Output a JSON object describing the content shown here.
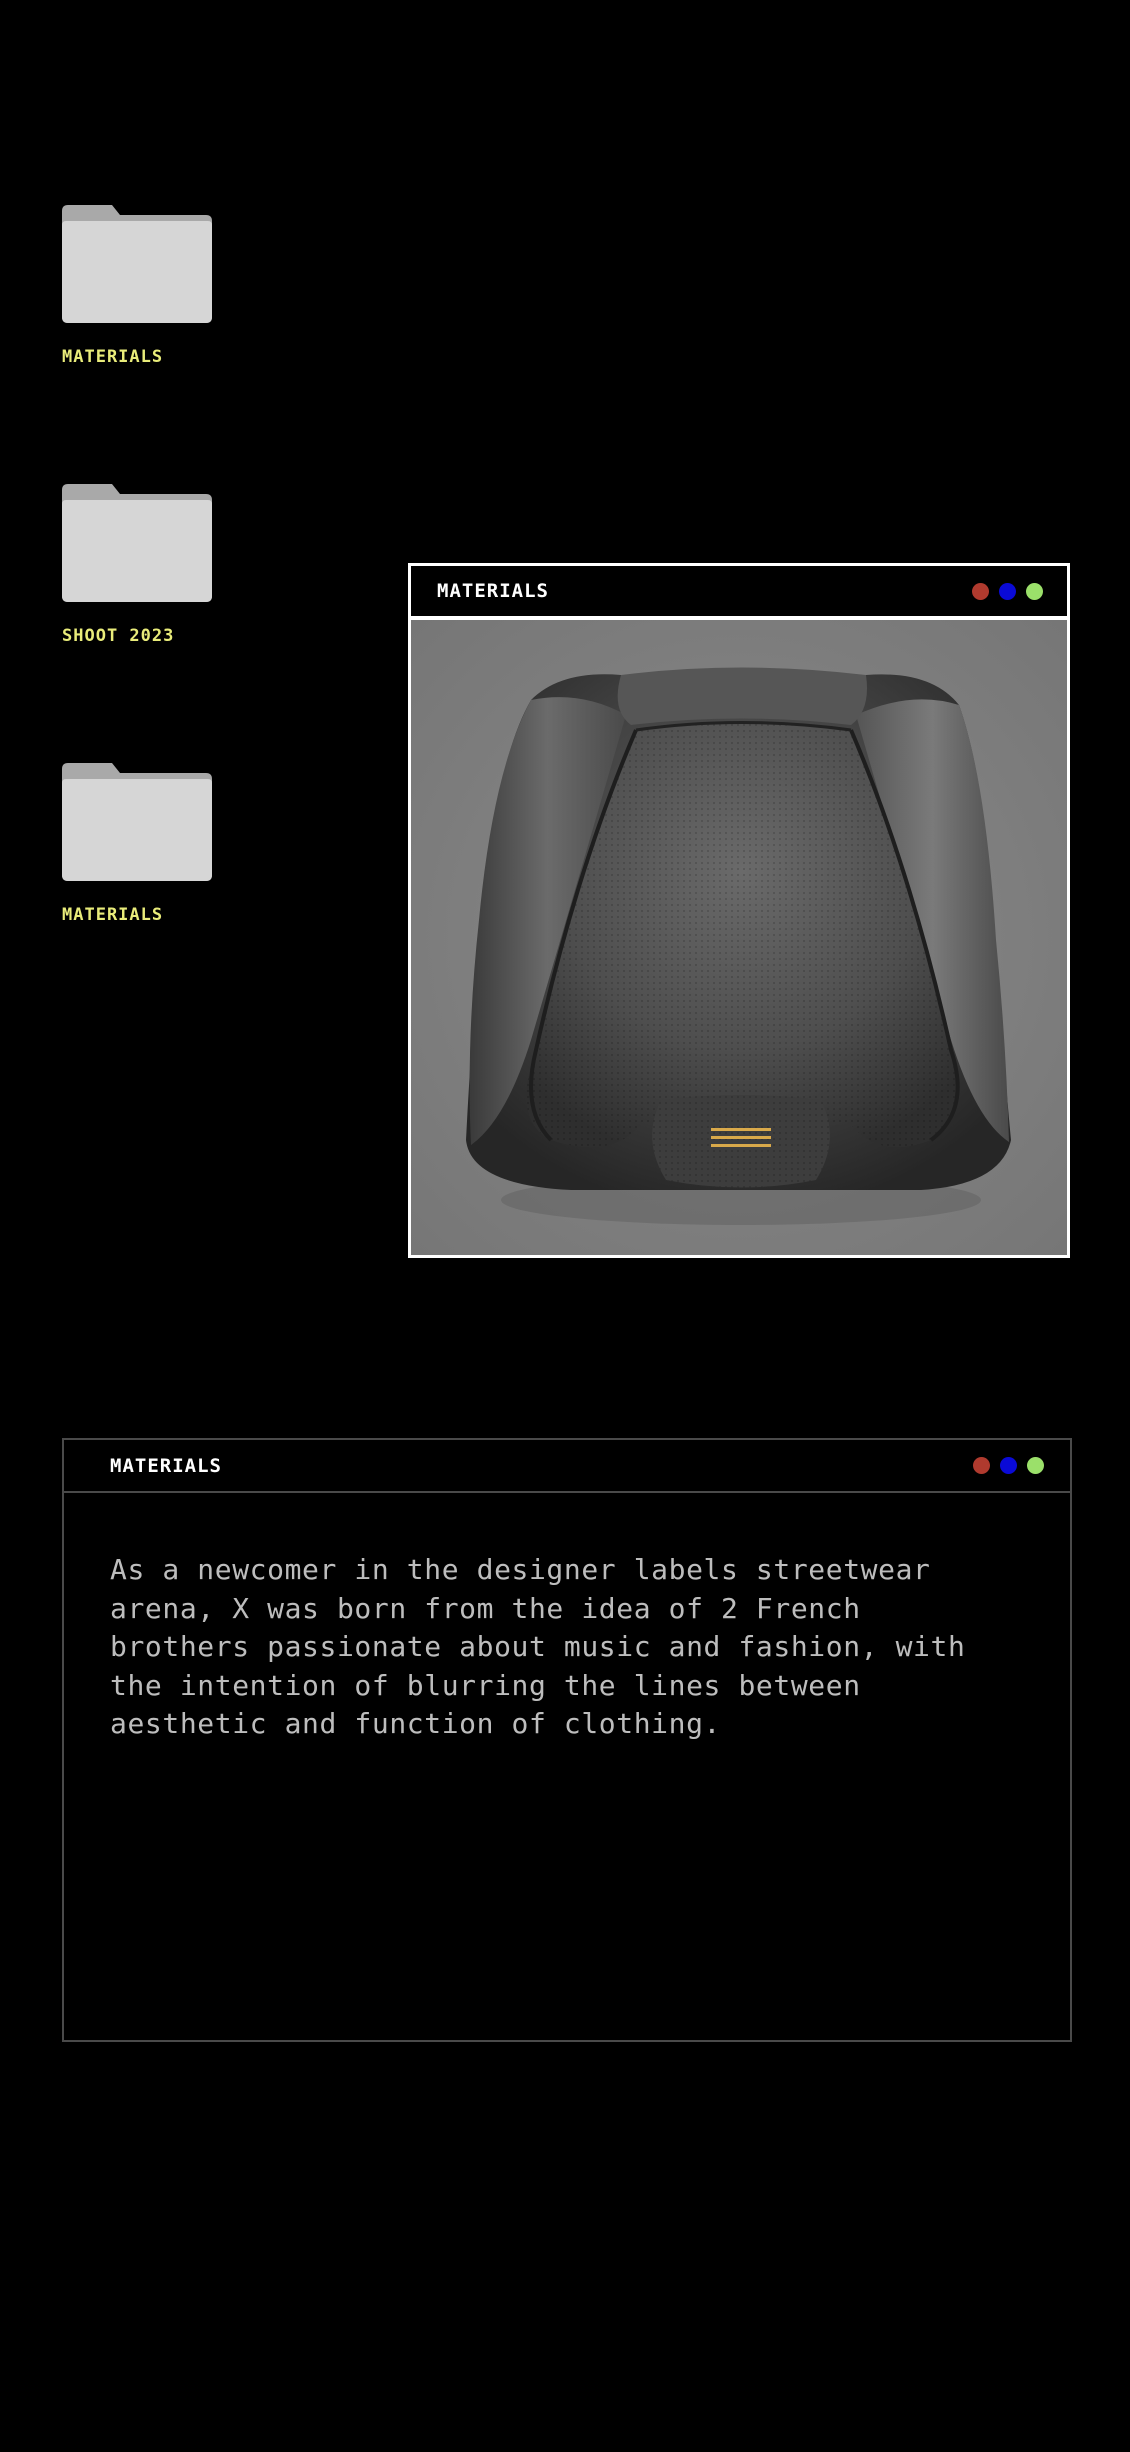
{
  "desktop": {
    "folders": [
      {
        "label": "MATERIALS"
      },
      {
        "label": "SHOOT 2023"
      },
      {
        "label": "MATERIALS"
      }
    ]
  },
  "image_window": {
    "title": "MATERIALS",
    "image_icon": "padded-backpack-image"
  },
  "text_window": {
    "title": "MATERIALS",
    "body": "As a newcomer in the designer labels streetwear arena, X was born from the idea of 2 French brothers passionate about music and fashion, with the intention of blurring the lines between aesthetic and function of clothing."
  },
  "window_controls": {
    "close_color": "#b03a2e",
    "minimize_color": "#0a0ad6",
    "maximize_color": "#9be06a"
  },
  "colors": {
    "background": "#000000",
    "folder_label": "#e9ec7a",
    "folder_fill": "#d6d6d6",
    "accent_stripes": "#d9a94a"
  }
}
